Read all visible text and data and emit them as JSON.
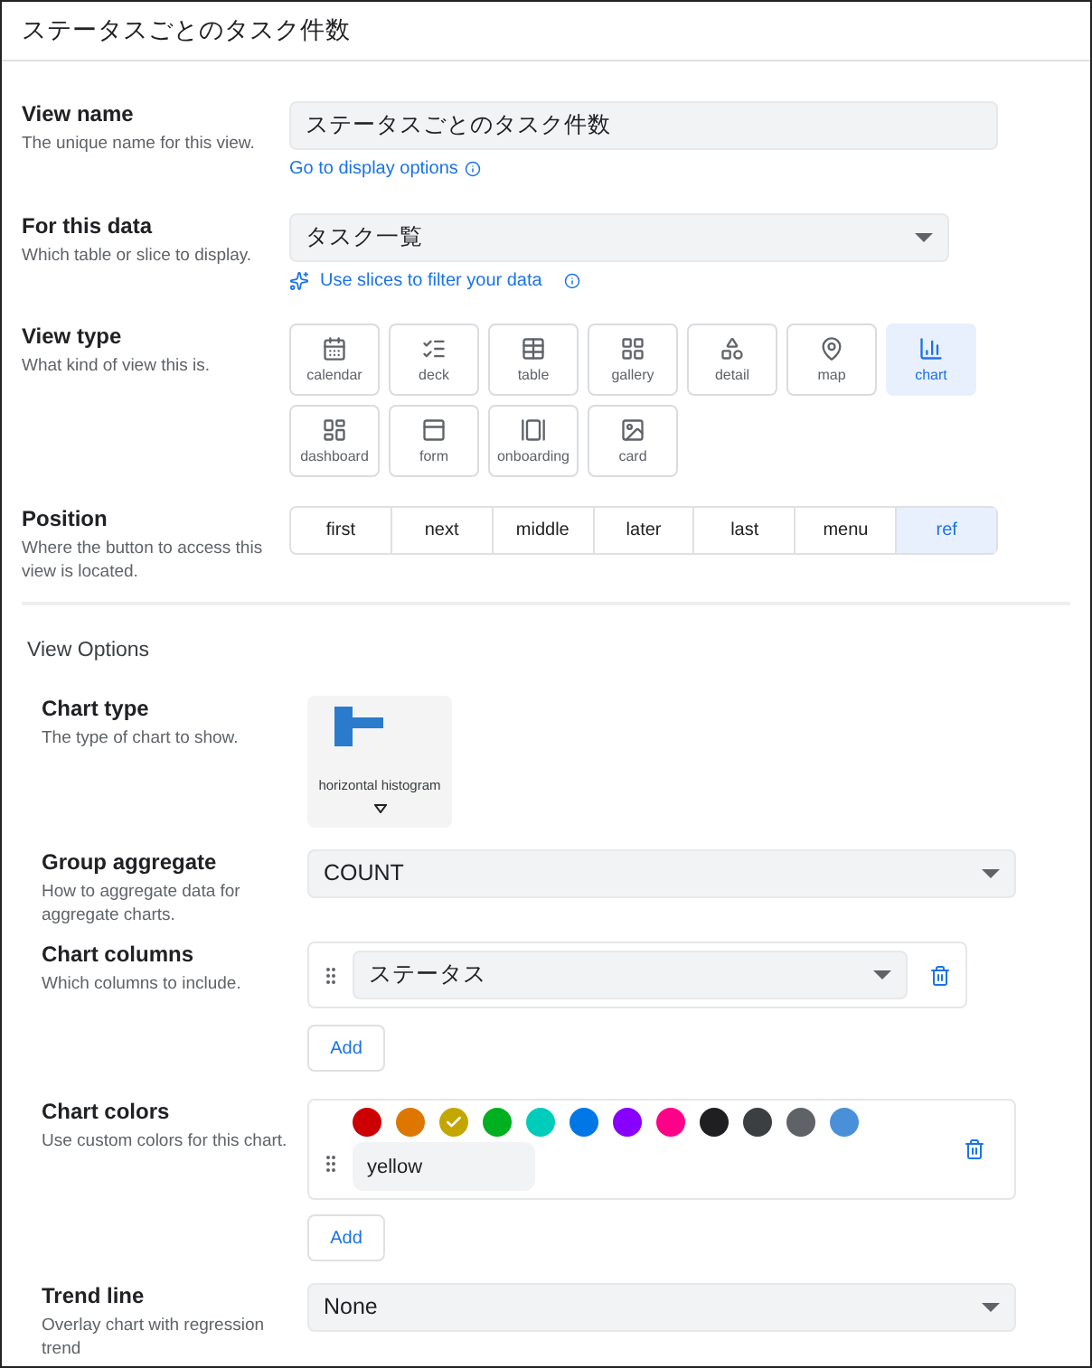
{
  "header": {
    "title": "ステータスごとのタスク件数"
  },
  "view_name": {
    "label": "View name",
    "description": "The unique name for this view.",
    "value": "ステータスごとのタスク件数",
    "link": "Go to display options"
  },
  "for_this_data": {
    "label": "For this data",
    "description": "Which table or slice to display.",
    "value": "タスク一覧",
    "link": "Use slices to filter your data"
  },
  "view_type": {
    "label": "View type",
    "description": "What kind of view this is.",
    "options": [
      {
        "label": "calendar",
        "selected": false
      },
      {
        "label": "deck",
        "selected": false
      },
      {
        "label": "table",
        "selected": false
      },
      {
        "label": "gallery",
        "selected": false
      },
      {
        "label": "detail",
        "selected": false
      },
      {
        "label": "map",
        "selected": false
      },
      {
        "label": "chart",
        "selected": true
      },
      {
        "label": "dashboard",
        "selected": false
      },
      {
        "label": "form",
        "selected": false
      },
      {
        "label": "onboarding",
        "selected": false
      },
      {
        "label": "card",
        "selected": false
      }
    ]
  },
  "position": {
    "label": "Position",
    "description": "Where the button to access this view is located.",
    "options": [
      {
        "label": "first",
        "selected": false
      },
      {
        "label": "next",
        "selected": false
      },
      {
        "label": "middle",
        "selected": false
      },
      {
        "label": "later",
        "selected": false
      },
      {
        "label": "last",
        "selected": false
      },
      {
        "label": "menu",
        "selected": false
      },
      {
        "label": "ref",
        "selected": true
      }
    ]
  },
  "view_options": {
    "title": "View Options",
    "chart_type": {
      "label": "Chart type",
      "description": "The type of chart to show.",
      "value": "horizontal histogram"
    },
    "group_aggregate": {
      "label": "Group aggregate",
      "description": "How to aggregate data for aggregate charts.",
      "value": "COUNT"
    },
    "chart_columns": {
      "label": "Chart columns",
      "description": "Which columns to include.",
      "items": [
        {
          "value": "ステータス"
        }
      ],
      "add_button": "Add"
    },
    "chart_colors": {
      "label": "Chart colors",
      "description": "Use custom colors for this chart.",
      "swatches": [
        {
          "color": "#cc0000",
          "selected": false
        },
        {
          "color": "#dd7700",
          "selected": false
        },
        {
          "color": "#c4a600",
          "selected": true
        },
        {
          "color": "#00b020",
          "selected": false
        },
        {
          "color": "#00ccbb",
          "selected": false
        },
        {
          "color": "#0077e6",
          "selected": false
        },
        {
          "color": "#8800ff",
          "selected": false
        },
        {
          "color": "#ff0088",
          "selected": false
        },
        {
          "color": "#1f1f22",
          "selected": false
        },
        {
          "color": "#3c3f42",
          "selected": false
        },
        {
          "color": "#5f6368",
          "selected": false
        },
        {
          "color": "#4a90d9",
          "selected": false
        }
      ],
      "value": "yellow",
      "add_button": "Add"
    },
    "trend_line": {
      "label": "Trend line",
      "description": "Overlay chart with regression trend",
      "value": "None"
    }
  }
}
